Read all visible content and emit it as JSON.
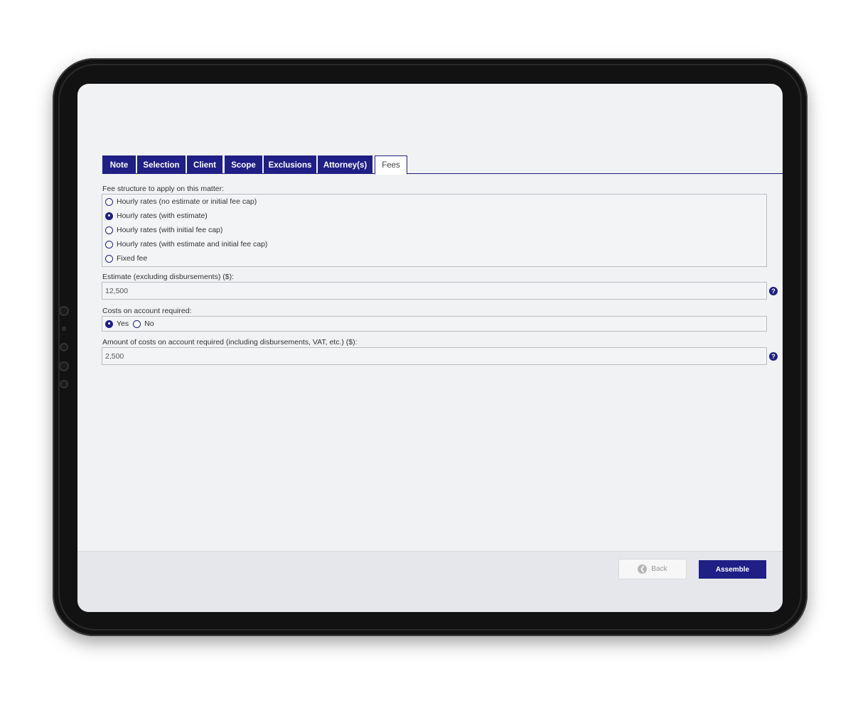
{
  "tabs": [
    {
      "label": "Note"
    },
    {
      "label": "Selection"
    },
    {
      "label": "Client"
    },
    {
      "label": "Scope"
    },
    {
      "label": "Exclusions"
    },
    {
      "label": "Attorney(s)"
    },
    {
      "label": "Fees",
      "active": true
    }
  ],
  "fee_structure": {
    "label": "Fee structure to apply on this matter:",
    "options": [
      {
        "label": "Hourly rates (no estimate or initial fee cap)",
        "selected": false
      },
      {
        "label": "Hourly rates (with estimate)",
        "selected": true
      },
      {
        "label": "Hourly rates (with initial fee cap)",
        "selected": false
      },
      {
        "label": "Hourly rates (with estimate and initial fee cap)",
        "selected": false
      },
      {
        "label": "Fixed fee",
        "selected": false
      }
    ]
  },
  "estimate": {
    "label": "Estimate (excluding disbursements) ($):",
    "value": "12,500"
  },
  "costs_on_account": {
    "label": "Costs on account required:",
    "yes_label": "Yes",
    "no_label": "No",
    "selected": "Yes"
  },
  "costs_amount": {
    "label": "Amount of costs on account required (including disbursements, VAT, etc.) ($):",
    "value": "2,500"
  },
  "help_glyph": "?",
  "footer": {
    "back_label": "Back",
    "assemble_label": "Assemble"
  },
  "colors": {
    "accent": "#1f1f85",
    "background": "#f1f2f4"
  }
}
